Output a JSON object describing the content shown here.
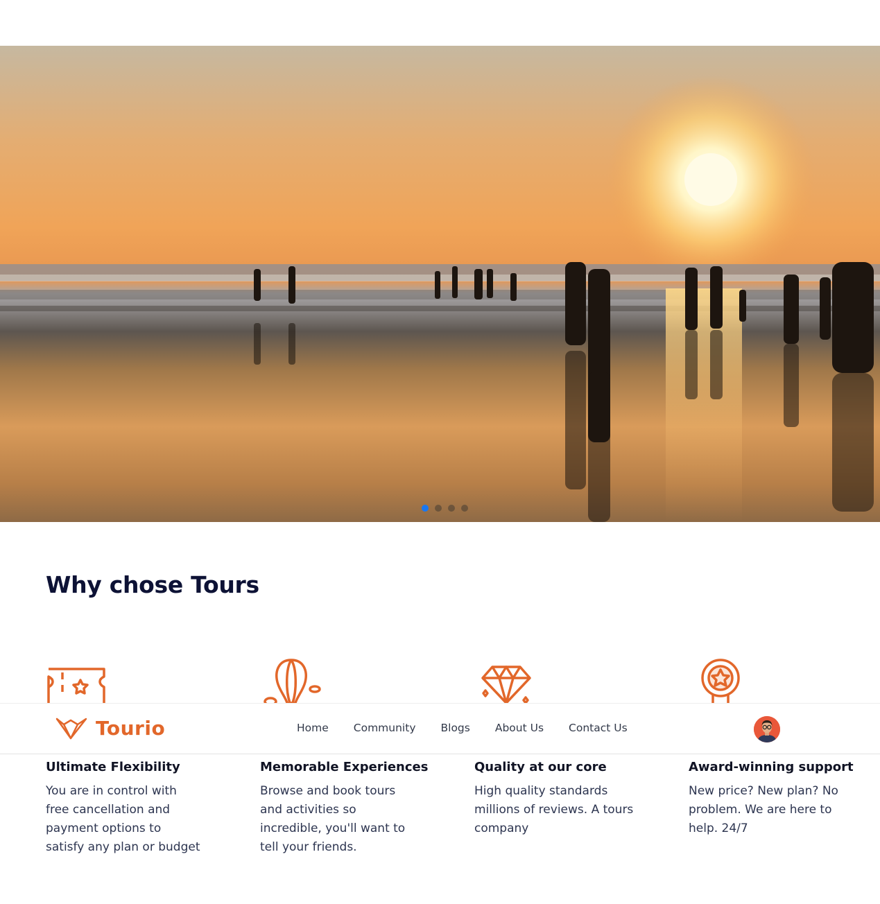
{
  "hero": {
    "slides_count": 4,
    "active_slide": 1
  },
  "section": {
    "title": "Why chose Tours"
  },
  "features": [
    {
      "title": "Ultimate Flexibility",
      "description": "You are in control with free cancellation and payment options to satisfy any plan or budget",
      "icon": "ticket-icon"
    },
    {
      "title": "Memorable Experiences",
      "description": "Browse and book tours and activities so incredible, you'll want to tell your friends.",
      "icon": "hot-air-balloon-icon"
    },
    {
      "title": "Quality at our core",
      "description": "High quality standards millions of reviews. A tours company",
      "icon": "diamond-icon"
    },
    {
      "title": "Award-winning support",
      "description": "New price? New plan? No problem. We are here to help. 24/7",
      "icon": "award-medal-icon"
    }
  ],
  "navbar": {
    "brand": "Tourio",
    "links": [
      "Home",
      "Community",
      "Blogs",
      "About Us",
      "Contact Us"
    ]
  },
  "colors": {
    "accent": "#e2672a",
    "heading": "#0d1235",
    "active_dot": "#1877f2"
  }
}
